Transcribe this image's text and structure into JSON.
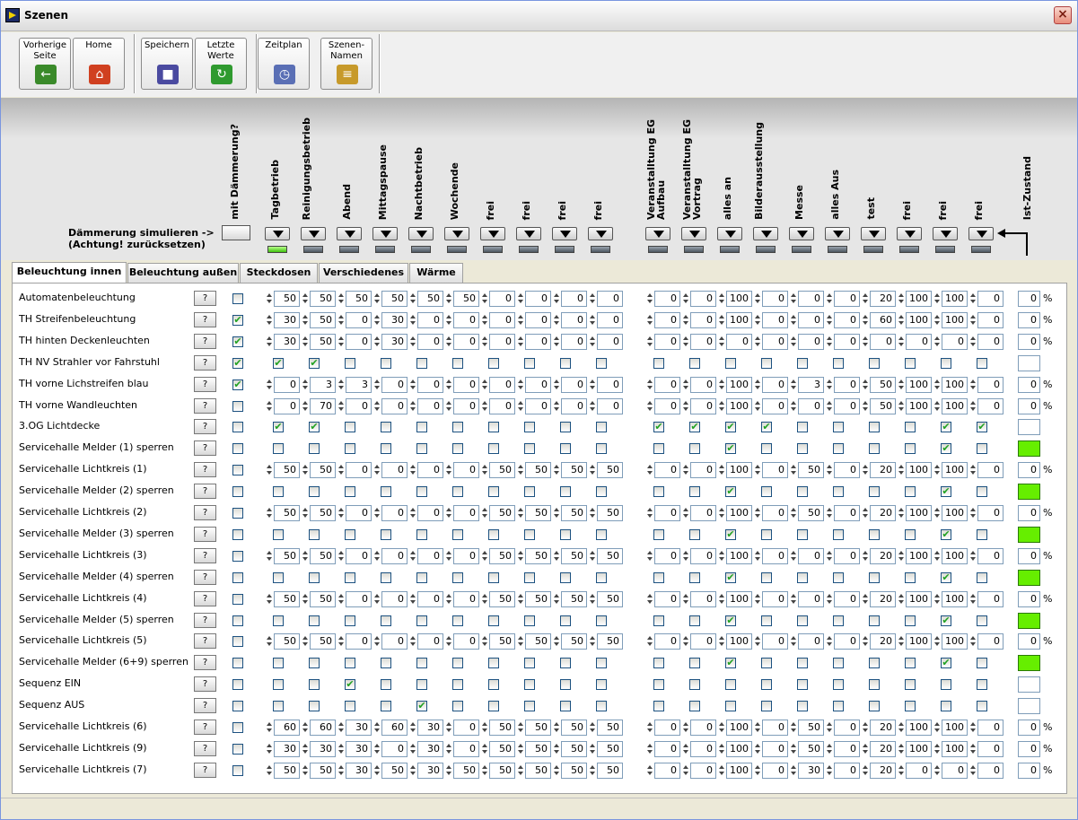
{
  "window": {
    "title": "Szenen",
    "close_label": "×"
  },
  "toolbar": {
    "buttons": [
      {
        "label": "Vorherige Seite",
        "icon": "back-icon",
        "color": "#3a8a2a"
      },
      {
        "label": "Home",
        "icon": "home-icon",
        "color": "#d04020"
      },
      {
        "label": "Speichern",
        "icon": "save-icon",
        "color": "#4a4aa0"
      },
      {
        "label": "Letzte Werte",
        "icon": "refresh-icon",
        "color": "#2f9a2f"
      },
      {
        "label": "Zeitplan",
        "icon": "clock-icon",
        "color": "#5a6fb5"
      },
      {
        "label": "Szenen-Namen",
        "icon": "clipboard-icon",
        "color": "#c79a2b"
      }
    ]
  },
  "header": {
    "simulate_label": "Dämmerung simulieren   ->",
    "simulate_note": "(Achtung! zurücksetzen)",
    "dimming_label": "mit Dämmerung?",
    "actual_label": "Ist-Zustand",
    "scenes": [
      "Tagbetrieb",
      "Reinigungsbetrieb",
      "Abend",
      "Mittagspause",
      "Nachtbetrieb",
      "Wochende",
      "frei",
      "frei",
      "frei",
      "frei",
      "Veranstalltung EG Aufbau",
      "Veranstalltung EG Vortrag",
      "alles an",
      "Bilderausstellung",
      "Messe",
      "alles Aus",
      "test",
      "frei",
      "frei",
      "frei"
    ],
    "active_scene_index": 0
  },
  "tabs": [
    "Beleuchtung innen",
    "Beleuchtung außen",
    "Steckdosen",
    "Verschiedenes",
    "Wärme"
  ],
  "active_tab": 0,
  "help_label": "?",
  "percent_label": "%",
  "rows": [
    {
      "label": "Automatenbeleuchtung",
      "type": "num",
      "dim": false,
      "values": [
        50,
        50,
        50,
        50,
        50,
        50,
        0,
        0,
        0,
        0,
        0,
        0,
        100,
        0,
        0,
        0,
        20,
        100,
        100,
        0
      ],
      "actual": "0"
    },
    {
      "label": "TH Streifenbeleuchtung",
      "type": "num",
      "dim": true,
      "values": [
        30,
        50,
        0,
        30,
        0,
        0,
        0,
        0,
        0,
        0,
        0,
        0,
        100,
        0,
        0,
        0,
        60,
        100,
        100,
        0
      ],
      "actual": "0"
    },
    {
      "label": "TH hinten Deckenleuchten",
      "type": "num",
      "dim": true,
      "values": [
        30,
        50,
        0,
        30,
        0,
        0,
        0,
        0,
        0,
        0,
        0,
        0,
        0,
        0,
        0,
        0,
        0,
        0,
        0,
        0
      ],
      "actual": "0"
    },
    {
      "label": "TH NV Strahler vor Fahrstuhl",
      "type": "bool",
      "dim": true,
      "values": [
        1,
        1,
        0,
        0,
        0,
        0,
        0,
        0,
        0,
        0,
        0,
        0,
        0,
        0,
        0,
        0,
        0,
        0,
        0,
        0
      ],
      "actual": ""
    },
    {
      "label": "TH vorne Lichstreifen blau",
      "type": "num",
      "dim": true,
      "values": [
        0,
        3,
        3,
        0,
        0,
        0,
        0,
        0,
        0,
        0,
        0,
        0,
        100,
        0,
        3,
        0,
        50,
        100,
        100,
        0
      ],
      "actual": "0"
    },
    {
      "label": "TH vorne Wandleuchten",
      "type": "num",
      "dim": false,
      "values": [
        0,
        70,
        0,
        0,
        0,
        0,
        0,
        0,
        0,
        0,
        0,
        0,
        100,
        0,
        0,
        0,
        50,
        100,
        100,
        0
      ],
      "actual": "0"
    },
    {
      "label": "3.OG Lichtdecke",
      "type": "bool",
      "dim": false,
      "values": [
        1,
        1,
        0,
        0,
        0,
        0,
        0,
        0,
        0,
        0,
        1,
        1,
        1,
        1,
        0,
        0,
        0,
        0,
        1,
        1
      ],
      "actual": ""
    },
    {
      "label": "Servicehalle Melder (1) sperren",
      "type": "bool",
      "dim": false,
      "values": [
        0,
        0,
        0,
        0,
        0,
        0,
        0,
        0,
        0,
        0,
        0,
        0,
        1,
        0,
        0,
        0,
        0,
        0,
        1,
        0
      ],
      "actual": "green"
    },
    {
      "label": "Servicehalle Lichtkreis (1)",
      "type": "num",
      "dim": false,
      "values": [
        50,
        50,
        0,
        0,
        0,
        0,
        50,
        50,
        50,
        50,
        0,
        0,
        100,
        0,
        50,
        0,
        20,
        100,
        100,
        0
      ],
      "actual": "0"
    },
    {
      "label": "Servicehalle Melder (2) sperren",
      "type": "bool",
      "dim": false,
      "values": [
        0,
        0,
        0,
        0,
        0,
        0,
        0,
        0,
        0,
        0,
        0,
        0,
        1,
        0,
        0,
        0,
        0,
        0,
        1,
        0
      ],
      "actual": "green"
    },
    {
      "label": "Servicehalle Lichtkreis (2)",
      "type": "num",
      "dim": false,
      "values": [
        50,
        50,
        0,
        0,
        0,
        0,
        50,
        50,
        50,
        50,
        0,
        0,
        100,
        0,
        50,
        0,
        20,
        100,
        100,
        0
      ],
      "actual": "0"
    },
    {
      "label": "Servicehalle Melder (3) sperren",
      "type": "bool",
      "dim": false,
      "values": [
        0,
        0,
        0,
        0,
        0,
        0,
        0,
        0,
        0,
        0,
        0,
        0,
        1,
        0,
        0,
        0,
        0,
        0,
        1,
        0
      ],
      "actual": "green"
    },
    {
      "label": "Servicehalle Lichtkreis (3)",
      "type": "num",
      "dim": false,
      "values": [
        50,
        50,
        0,
        0,
        0,
        0,
        50,
        50,
        50,
        50,
        0,
        0,
        100,
        0,
        0,
        0,
        20,
        100,
        100,
        0
      ],
      "actual": "0"
    },
    {
      "label": "Servicehalle Melder (4) sperren",
      "type": "bool",
      "dim": false,
      "values": [
        0,
        0,
        0,
        0,
        0,
        0,
        0,
        0,
        0,
        0,
        0,
        0,
        1,
        0,
        0,
        0,
        0,
        0,
        1,
        0
      ],
      "actual": "green"
    },
    {
      "label": "Servicehalle Lichtkreis (4)",
      "type": "num",
      "dim": false,
      "values": [
        50,
        50,
        0,
        0,
        0,
        0,
        50,
        50,
        50,
        50,
        0,
        0,
        100,
        0,
        0,
        0,
        20,
        100,
        100,
        0
      ],
      "actual": "0"
    },
    {
      "label": "Servicehalle Melder (5) sperren",
      "type": "bool",
      "dim": false,
      "values": [
        0,
        0,
        0,
        0,
        0,
        0,
        0,
        0,
        0,
        0,
        0,
        0,
        1,
        0,
        0,
        0,
        0,
        0,
        1,
        0
      ],
      "actual": "green"
    },
    {
      "label": "Servicehalle Lichtkreis (5)",
      "type": "num",
      "dim": false,
      "values": [
        50,
        50,
        0,
        0,
        0,
        0,
        50,
        50,
        50,
        50,
        0,
        0,
        100,
        0,
        0,
        0,
        20,
        100,
        100,
        0
      ],
      "actual": "0"
    },
    {
      "label": "Servicehalle Melder (6+9) sperren",
      "type": "bool",
      "dim": false,
      "values": [
        0,
        0,
        0,
        0,
        0,
        0,
        0,
        0,
        0,
        0,
        0,
        0,
        1,
        0,
        0,
        0,
        0,
        0,
        1,
        0
      ],
      "actual": "green"
    },
    {
      "label": "Sequenz EIN",
      "type": "bool",
      "dim": false,
      "values": [
        0,
        0,
        1,
        0,
        0,
        0,
        0,
        0,
        0,
        0,
        0,
        0,
        0,
        0,
        0,
        0,
        0,
        0,
        0,
        0
      ],
      "actual": ""
    },
    {
      "label": "Sequenz AUS",
      "type": "bool",
      "dim": false,
      "values": [
        0,
        0,
        0,
        0,
        1,
        0,
        0,
        0,
        0,
        0,
        0,
        0,
        0,
        0,
        0,
        0,
        0,
        0,
        0,
        0
      ],
      "actual": ""
    },
    {
      "label": "Servicehalle Lichtkreis (6)",
      "type": "num",
      "dim": false,
      "values": [
        60,
        60,
        30,
        60,
        30,
        0,
        50,
        50,
        50,
        50,
        0,
        0,
        100,
        0,
        50,
        0,
        20,
        100,
        100,
        0
      ],
      "actual": "0"
    },
    {
      "label": "Servicehalle Lichtkreis (9)",
      "type": "num",
      "dim": false,
      "values": [
        30,
        30,
        30,
        0,
        30,
        0,
        50,
        50,
        50,
        50,
        0,
        0,
        100,
        0,
        50,
        0,
        20,
        100,
        100,
        0
      ],
      "actual": "0"
    },
    {
      "label": "Servicehalle Lichtkreis (7)",
      "type": "num",
      "dim": false,
      "values": [
        50,
        50,
        30,
        50,
        30,
        50,
        50,
        50,
        50,
        50,
        0,
        0,
        100,
        0,
        30,
        0,
        20,
        0,
        0,
        0
      ],
      "actual": "0"
    }
  ]
}
